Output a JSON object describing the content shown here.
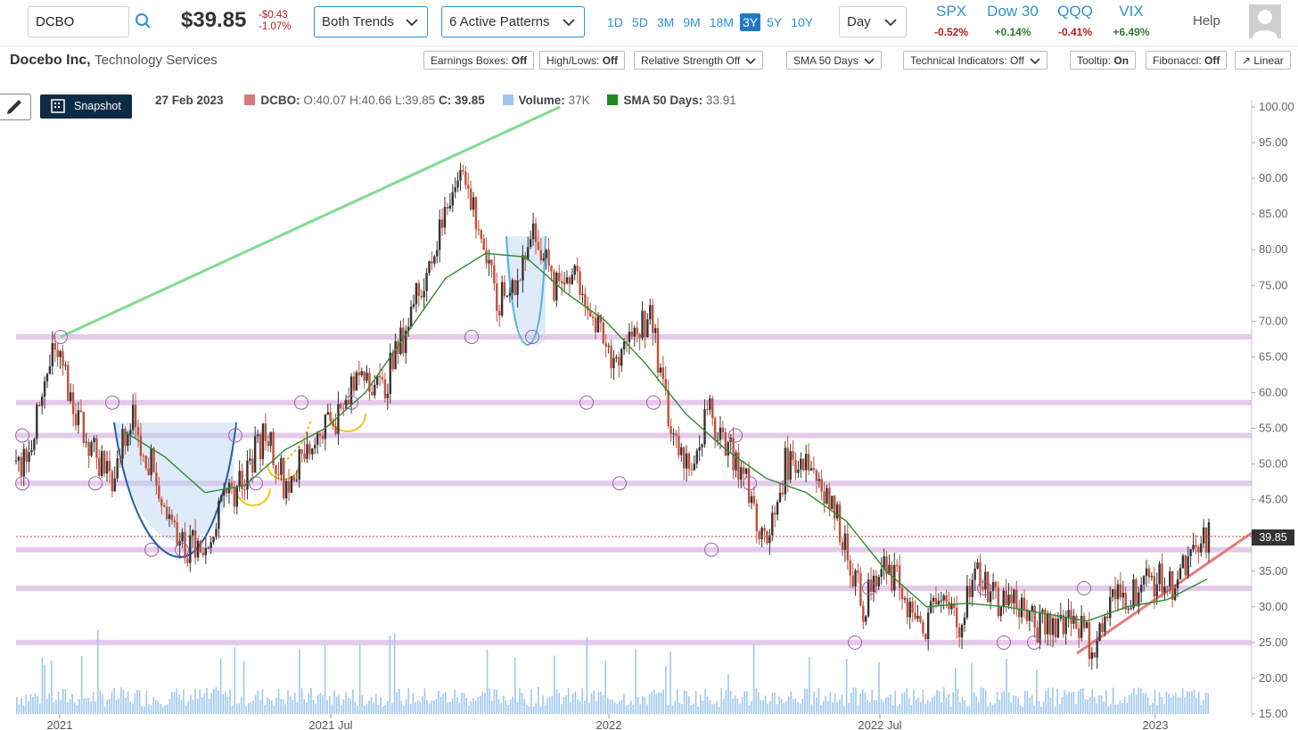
{
  "topbar": {
    "symbol_value": "DCBO",
    "price": "$39.85",
    "change_abs": "-$0.43",
    "change_pct": "-1.07%",
    "trend_select": "Both Trends",
    "pattern_select": "6 Active Patterns",
    "ranges": [
      "1D",
      "5D",
      "3M",
      "9M",
      "18M",
      "3Y",
      "5Y",
      "10Y"
    ],
    "active_range": "3Y",
    "interval_select": "Day",
    "indices": [
      {
        "name": "SPX",
        "value": "-0.52%",
        "color": "#b71c1c"
      },
      {
        "name": "Dow 30",
        "value": "+0.14%",
        "color": "#2e7d32"
      },
      {
        "name": "QQQ",
        "value": "-0.41%",
        "color": "#b71c1c"
      },
      {
        "name": "VIX",
        "value": "+6.49%",
        "color": "#2e7d32"
      }
    ],
    "help_label": "Help"
  },
  "company": {
    "name": "Docebo Inc,",
    "sector": "Technology Services"
  },
  "options": {
    "earnings_label": "Earnings Boxes:",
    "earnings_value": "Off",
    "highlows_label": "High/Lows:",
    "highlows_value": "Off",
    "relstrength_label": "Relative Strength Off",
    "sma_label": "SMA 50 Days",
    "tech_label": "Technical Indicators: Off",
    "tooltip_label": "Tooltip:",
    "tooltip_value": "On",
    "fib_label": "Fibonacci:",
    "fib_value": "Off",
    "scale_label": "Linear"
  },
  "legend": {
    "snapshot_label": "Snapshot",
    "date": "27 Feb 2023",
    "ticker_label": "DCBO:",
    "ohlc": "O:40.07 H:40.66 L:39.85",
    "close": "C: 39.85",
    "volume_label": "Volume:",
    "volume_value": "37K",
    "sma_label": "SMA 50 Days:",
    "sma_value": "33.91"
  },
  "colors": {
    "up": "#333333",
    "down": "#c0503c",
    "sma": "#2e8b2e",
    "support": "#d8b4e2",
    "trend_up": "#7fdc8f",
    "trend_low": "#e77a7a",
    "volume": "#9fc7ee",
    "accent": "#2f8fd8"
  },
  "chart_data": {
    "type": "candlestick",
    "y_axis_labels": [
      "100.00",
      "95.00",
      "90.00",
      "85.00",
      "80.00",
      "75.00",
      "70.00",
      "65.00",
      "60.00",
      "55.00",
      "50.00",
      "45.00",
      "40.00",
      "35.00",
      "30.00",
      "25.00",
      "20.00",
      "15.00"
    ],
    "ylim": [
      15,
      100
    ],
    "x_axis_labels": [
      "2021",
      "2021 Jul",
      "2022",
      "2022 Jul",
      "2023"
    ],
    "last_price_label": "39.85",
    "support_levels": [
      67.8,
      58.6,
      54.0,
      47.3,
      38.0,
      32.6,
      25.0
    ],
    "close_path": [
      [
        "2021-01",
        49
      ],
      [
        "2021-01",
        55
      ],
      [
        "2021-01",
        66
      ],
      [
        "2021-02",
        58
      ],
      [
        "2021-02",
        52
      ],
      [
        "2021-03",
        48
      ],
      [
        "2021-03",
        57
      ],
      [
        "2021-04",
        50
      ],
      [
        "2021-04",
        42
      ],
      [
        "2021-05",
        38
      ],
      [
        "2021-05",
        40
      ],
      [
        "2021-06",
        45
      ],
      [
        "2021-06",
        49
      ],
      [
        "2021-07",
        55
      ],
      [
        "2021-07",
        47
      ],
      [
        "2021-08",
        51
      ],
      [
        "2021-08",
        56
      ],
      [
        "2021-09",
        57
      ],
      [
        "2021-09",
        64
      ],
      [
        "2021-10",
        60
      ],
      [
        "2021-10",
        67
      ],
      [
        "2021-11",
        75
      ],
      [
        "2021-11",
        82
      ],
      [
        "2021-12",
        92
      ],
      [
        "2021-12",
        84
      ],
      [
        "2022-01",
        72
      ],
      [
        "2022-01",
        76
      ],
      [
        "2022-02",
        83
      ],
      [
        "2022-02",
        74
      ],
      [
        "2022-03",
        78
      ],
      [
        "2022-03",
        70
      ],
      [
        "2022-04",
        64
      ],
      [
        "2022-04",
        69
      ],
      [
        "2022-05",
        70
      ],
      [
        "2022-05",
        55
      ],
      [
        "2022-06",
        50
      ],
      [
        "2022-06",
        57
      ],
      [
        "2022-07",
        53
      ],
      [
        "2022-07",
        47
      ],
      [
        "2022-08",
        38
      ],
      [
        "2022-08",
        50
      ],
      [
        "2022-09",
        51
      ],
      [
        "2022-09",
        47
      ],
      [
        "2022-10",
        40
      ],
      [
        "2022-10",
        30
      ],
      [
        "2022-11",
        35
      ],
      [
        "2022-11",
        33
      ],
      [
        "2022-12",
        26
      ],
      [
        "2022-12",
        31
      ],
      [
        "2023-01",
        28
      ],
      [
        "2023-01",
        35
      ],
      [
        "2023-02",
        31
      ],
      [
        "2023-02",
        31
      ],
      [
        "2023-03",
        27
      ],
      [
        "2023-03",
        28
      ],
      [
        "2023-04",
        29
      ],
      [
        "2023-04",
        24
      ],
      [
        "2023-05",
        31
      ],
      [
        "2023-05",
        32
      ],
      [
        "2023-06",
        34
      ],
      [
        "2023-06",
        33
      ],
      [
        "2023-07",
        36
      ],
      [
        "2023-07",
        40
      ]
    ],
    "sma_path": [
      [
        54.5
      ],
      [
        51
      ],
      [
        46
      ],
      [
        47
      ],
      [
        52
      ],
      [
        55
      ],
      [
        60
      ],
      [
        68
      ],
      [
        76
      ],
      [
        79.5
      ],
      [
        79
      ],
      [
        74
      ],
      [
        70
      ],
      [
        64
      ],
      [
        57
      ],
      [
        52
      ],
      [
        48
      ],
      [
        46
      ],
      [
        42
      ],
      [
        35
      ],
      [
        30
      ],
      [
        30.5
      ],
      [
        30
      ],
      [
        29
      ],
      [
        28
      ],
      [
        30
      ],
      [
        31
      ],
      [
        33.9
      ]
    ]
  }
}
